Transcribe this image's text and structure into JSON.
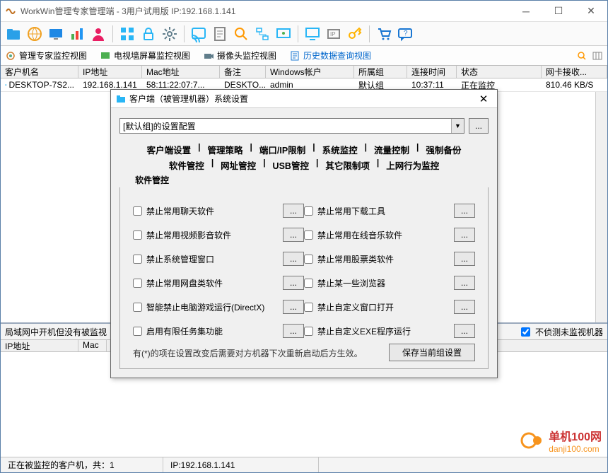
{
  "window": {
    "title": "WorkWin管理专家管理端 - 3用户试用版 IP:192.168.1.141"
  },
  "views": {
    "v1": "管理专家监控视图",
    "v2": "电视墙屏幕监控视图",
    "v3": "摄像头监控视图",
    "v4": "历史数据查询视图"
  },
  "table": {
    "headers": {
      "c1": "客户机名",
      "c2": "IP地址",
      "c3": "Mac地址",
      "c4": "备注",
      "c5": "Windows帐户",
      "c6": "所属组",
      "c7": "连接时间",
      "c8": "状态",
      "c9": "网卡接收..."
    },
    "row": {
      "c1": "DESKTOP-7S2...",
      "c2": "192.168.1.141",
      "c3": "58:11:22:07:7...",
      "c4": "DESKTO...",
      "c5": "admin",
      "c6": "默认组",
      "c7": "10:37:11",
      "c8": "正在监控",
      "c9": "810.46 KB/S"
    }
  },
  "lower": {
    "title": "局域网中开机但没有被监视",
    "chk": "不侦测未监视机器",
    "h1": "IP地址",
    "h2": "Mac"
  },
  "status": {
    "s1": "正在被监控的客户机，共：1",
    "s2": "IP:192.168.1.141"
  },
  "watermark": {
    "brand": "单机100网",
    "url": "danji100.com"
  },
  "dialog": {
    "title": "客户端（被管理机器）系统设置",
    "combo": "[默认组]的设置配置",
    "tabs": {
      "t1": "客户端设置",
      "t2": "管理策略",
      "t3": "端口/IP限制",
      "t4": "系统监控",
      "t5": "流量控制",
      "t6": "强制备份",
      "t7": "软件管控",
      "t8": "网址管控",
      "t9": "USB管控",
      "t10": "其它限制项",
      "t11": "上网行为监控",
      "active": "软件管控"
    },
    "opts": {
      "l1": "禁止常用聊天软件",
      "l2": "禁止常用视频影音软件",
      "l3": "禁止系统管理窗口",
      "l4": "禁止常用网盘类软件",
      "l5": "智能禁止电脑游戏运行(DirectX)",
      "l6": "启用有限任务集功能",
      "r1": "禁止常用下载工具",
      "r2": "禁止常用在线音乐软件",
      "r3": "禁止常用股票类软件",
      "r4": "禁止某一些浏览器",
      "r5": "禁止自定义窗口打开",
      "r6": "禁止自定义EXE程序运行"
    },
    "note": "有(*)的项在设置改变后需要对方机器下次重新启动后方生效。",
    "save": "保存当前组设置",
    "dots": "..."
  }
}
